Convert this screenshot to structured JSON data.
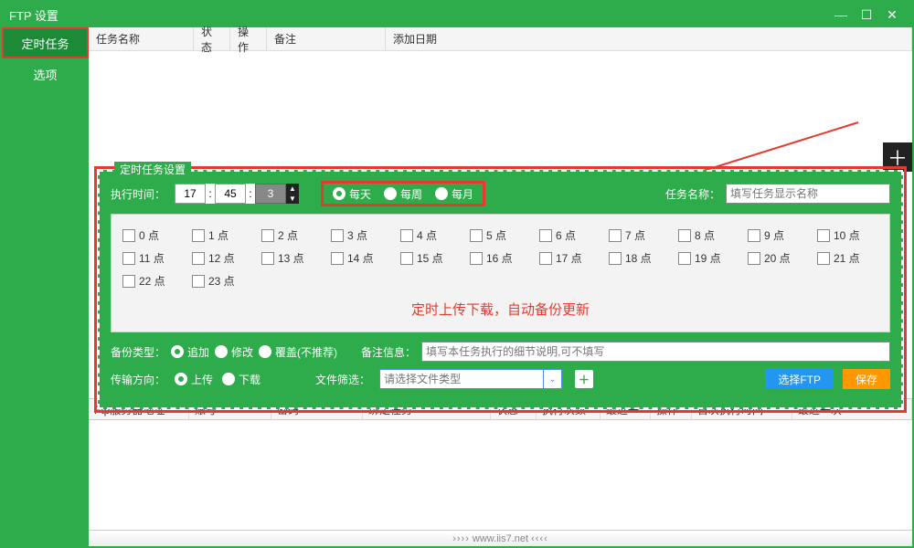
{
  "title": "FTP 设置",
  "sidebar": {
    "items": [
      {
        "label": "定时任务",
        "active": true
      },
      {
        "label": "选项",
        "active": false
      }
    ]
  },
  "tasks_table": {
    "headers": {
      "name": "任务名称",
      "state": "状态",
      "op": "操作",
      "remark": "备注",
      "date": "添加日期"
    }
  },
  "settings": {
    "legend": "定时任务设置",
    "exec_time_label": "执行时间：",
    "time": {
      "hour": "17",
      "minute": "45",
      "second": "3"
    },
    "frequency": {
      "options": [
        "每天",
        "每周",
        "每月"
      ],
      "selected": 0
    },
    "task_name_label": "任务名称：",
    "task_name_placeholder": "填写任务显示名称",
    "hours": [
      "0 点",
      "1 点",
      "2 点",
      "3 点",
      "4 点",
      "5 点",
      "6 点",
      "7 点",
      "8 点",
      "9 点",
      "10 点",
      "11 点",
      "12 点",
      "13 点",
      "14 点",
      "15 点",
      "16 点",
      "17 点",
      "18 点",
      "19 点",
      "20 点",
      "21 点",
      "22 点",
      "23 点"
    ],
    "promo": "定时上传下载，自动备份更新",
    "backup_type_label": "备份类型：",
    "backup_types": [
      "追加",
      "修改",
      "覆盖(不推荐)"
    ],
    "backup_selected": 0,
    "remark_label": "备注信息：",
    "remark_placeholder": "填写本任务执行的细节说明,可不填写",
    "direction_label": "传输方向：",
    "directions": [
      "上传",
      "下载"
    ],
    "direction_selected": 0,
    "file_filter_label": "文件筛选：",
    "file_filter_placeholder": "请选择文件类型",
    "select_ftp_btn": "选择FTP",
    "save_btn": "保存"
  },
  "ftp_table": {
    "headers": [
      "Ftp服务器地址",
      "账号",
      "密码",
      "绑定任务",
      "状态",
      "执行次数",
      "最近一",
      "操作",
      "首次执行时间",
      "最近一次"
    ]
  },
  "footer": "www.iis7.net"
}
